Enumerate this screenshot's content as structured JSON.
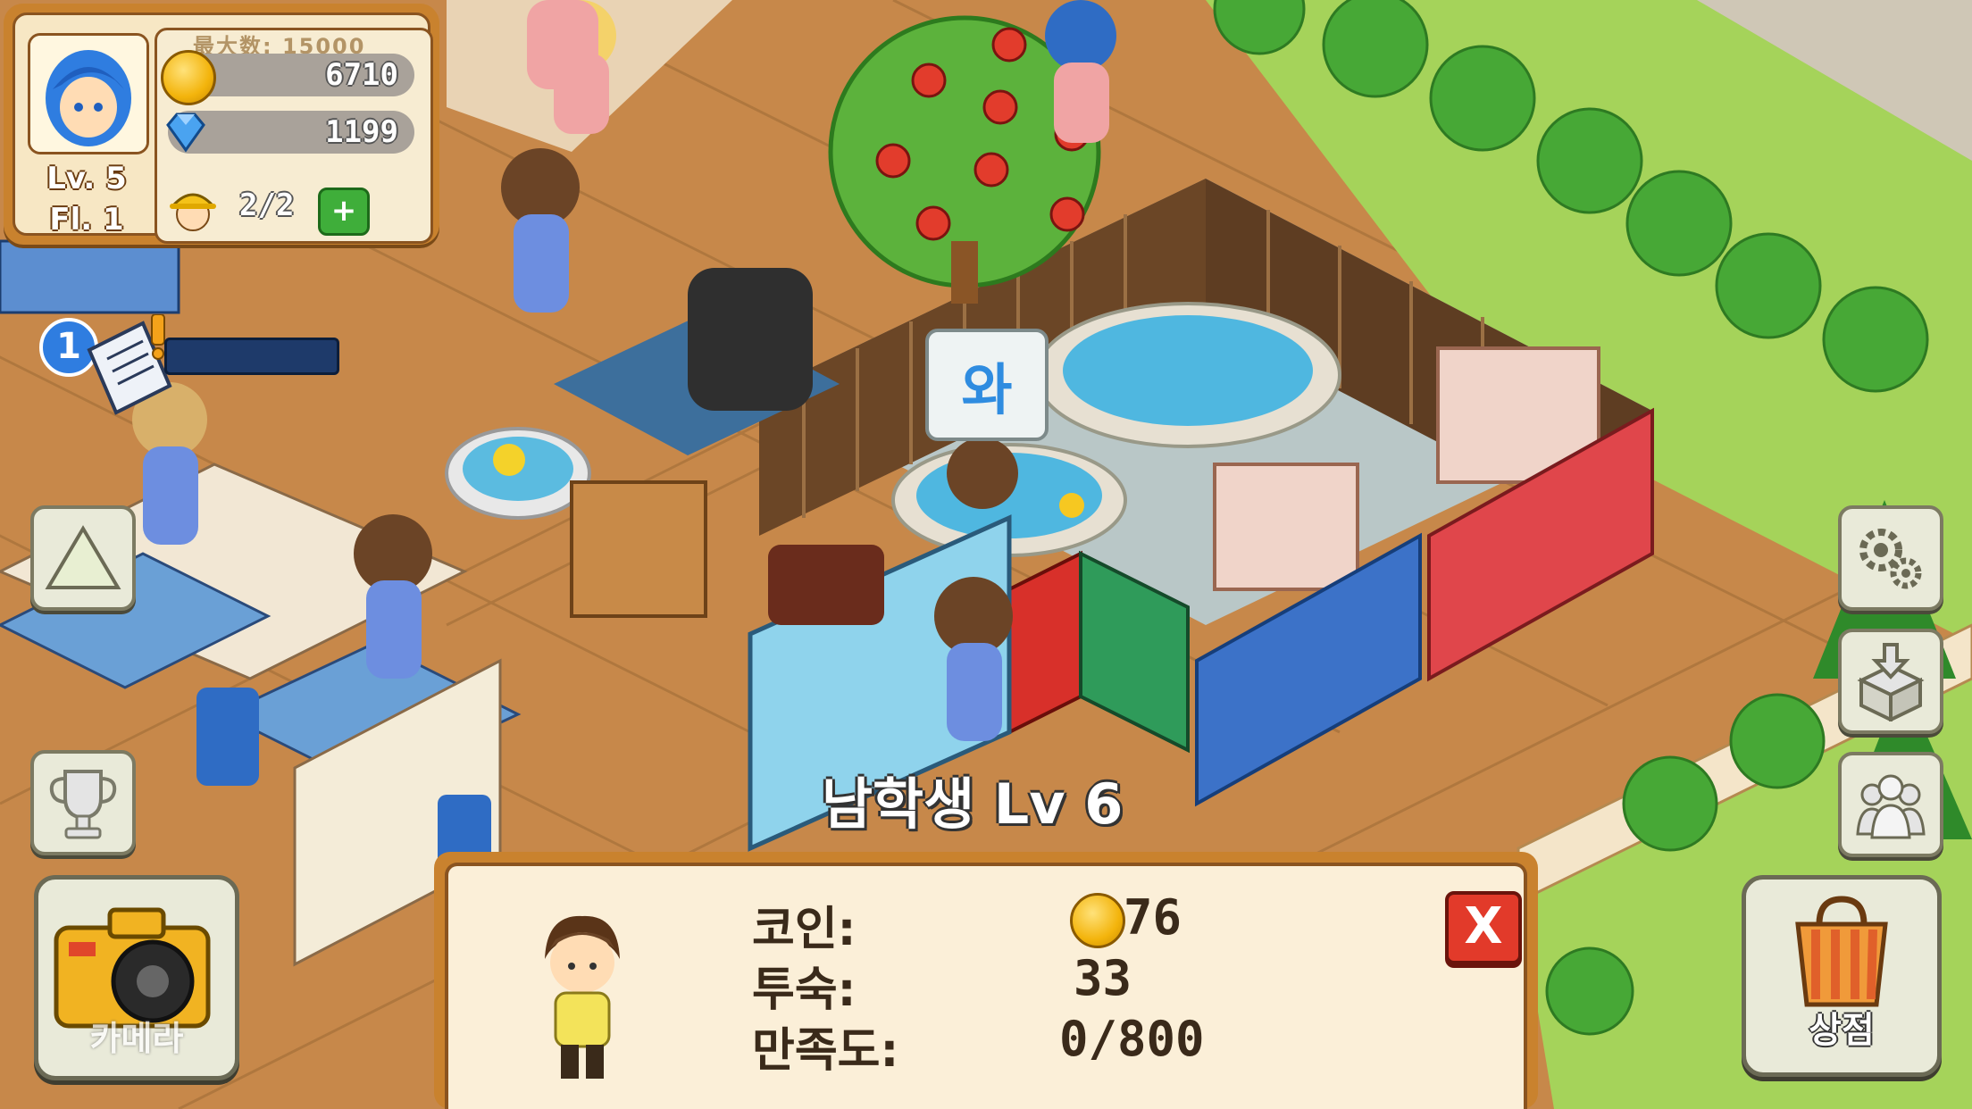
{
  "hud": {
    "level": "Lv. 5",
    "floor": "Fl. 1",
    "max_label": "最大数: 15000",
    "coins": "6710",
    "gems": "1199",
    "workers": "2/2",
    "add_worker": "+"
  },
  "quest": {
    "badge": "1"
  },
  "speech": {
    "text": "와"
  },
  "guest": {
    "name": "남학생 Lv 6"
  },
  "panel": {
    "coin_label": "코인:",
    "coin_value": "76",
    "stay_label": "투숙:",
    "stay_value": "33",
    "satisfaction_label": "만족도:",
    "satisfaction_value": "0/800",
    "close": "X"
  },
  "buttons": {
    "camera_label": "카메라",
    "shop_label": "상점"
  },
  "colors": {
    "floor": "#c98a4a",
    "hud_frame": "#c9822e",
    "panel_bg": "#fbefd8",
    "close_red": "#e23a2a",
    "plus_green": "#3fae3a"
  }
}
